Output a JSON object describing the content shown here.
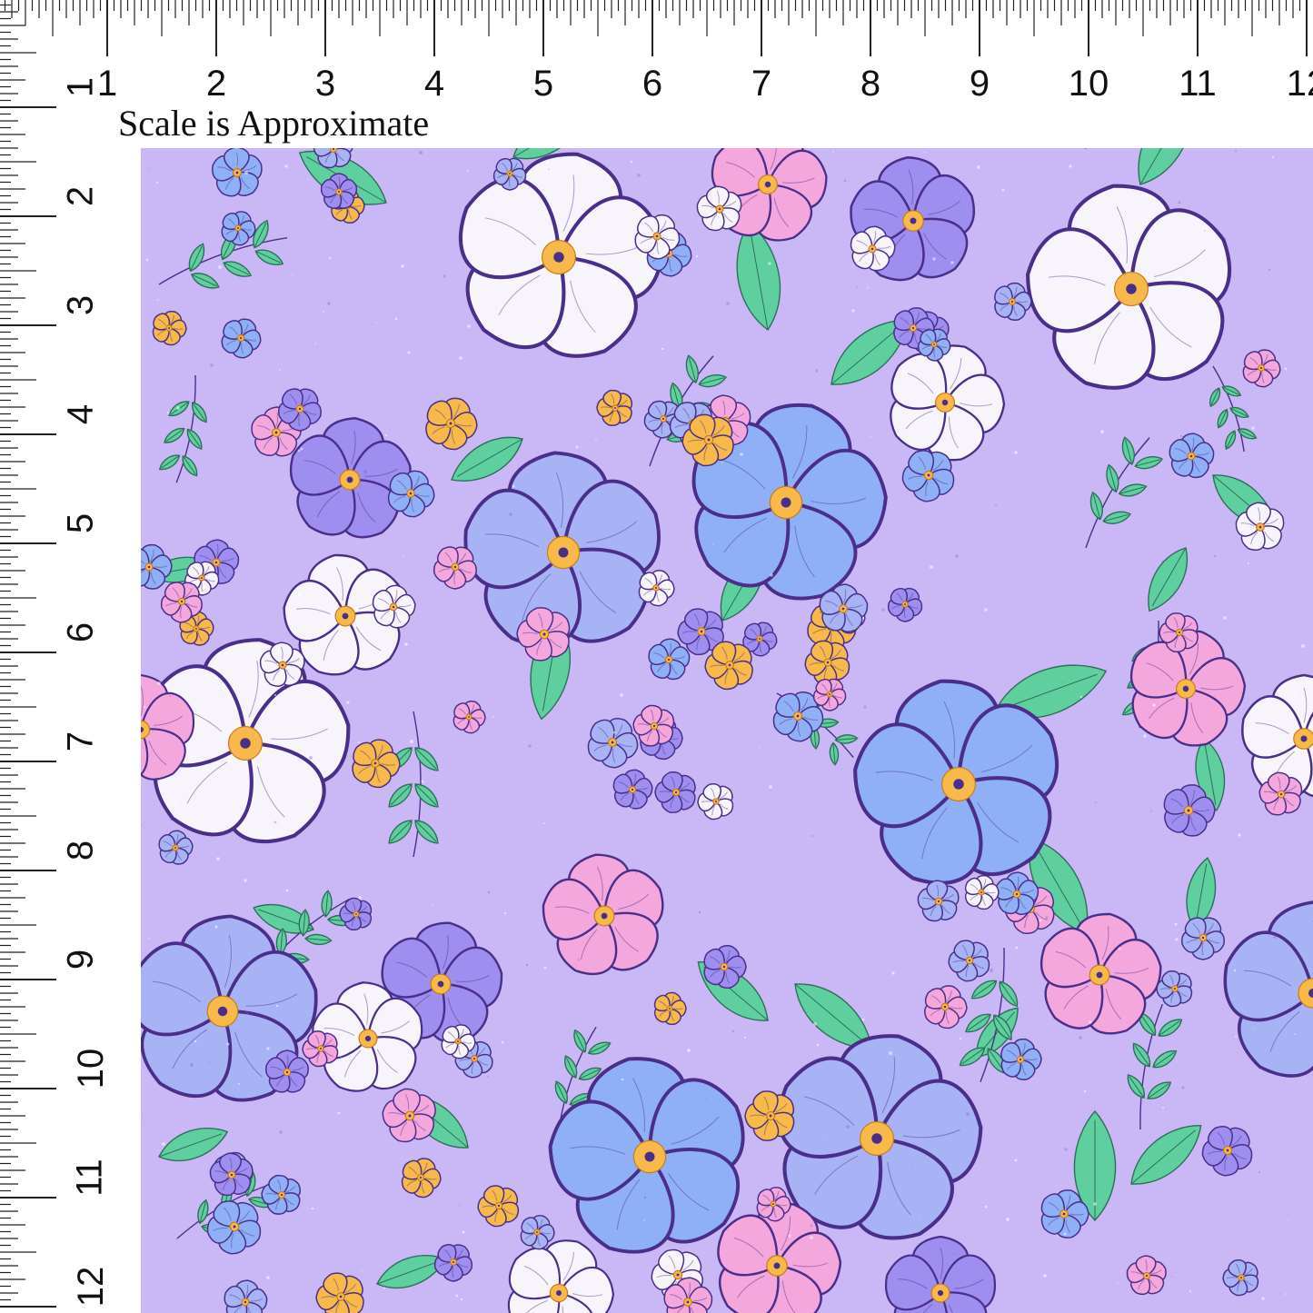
{
  "ruler": {
    "top_labels": [
      "1",
      "2",
      "3",
      "4",
      "5",
      "6",
      "7",
      "8",
      "9",
      "10",
      "11",
      "12"
    ],
    "left_labels": [
      "1",
      "2",
      "3",
      "4",
      "5",
      "6",
      "7",
      "8",
      "9",
      "10",
      "11",
      "12"
    ]
  },
  "caption": "Scale is Approximate",
  "swatch": {
    "background": "#c9b8f5",
    "colors": {
      "lavender": "#c9b8f5",
      "outline": "#4a2e8a",
      "periwinkle": "#a7b3f5",
      "blue": "#8fb0f7",
      "violet": "#9d8ef0",
      "white": "#f7f4fb",
      "pink": "#f3a7dc",
      "orange": "#f6b94a",
      "leaf": "#5fcf9f"
    },
    "motifs": [
      "large-flower",
      "medium-flower",
      "small-flower",
      "leaf-sprig"
    ]
  }
}
